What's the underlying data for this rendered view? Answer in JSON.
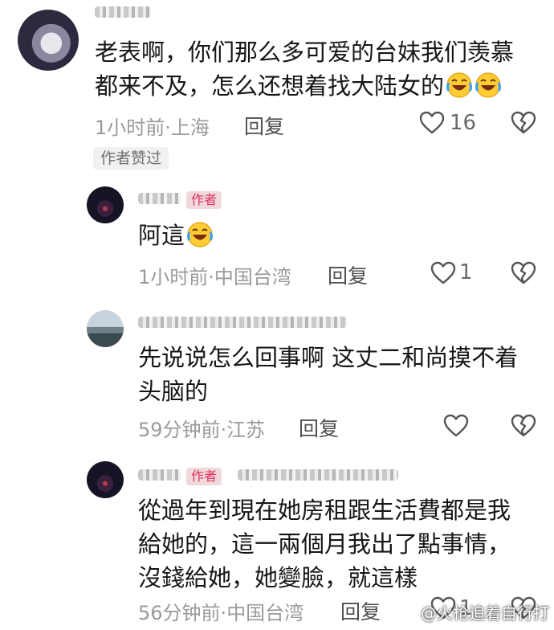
{
  "comments": [
    {
      "text_lines": [
        "老表啊，你们那么多可爱的台妹我们羡慕",
        "都来不及，怎么还想着找大陆女的"
      ],
      "emoji": [
        "laughing-crying-emoji",
        "laughing-crying-emoji"
      ],
      "time": "1小时前",
      "location": "上海",
      "reply_label": "回复",
      "likes": "16",
      "author_liked_tag": "作者赞过"
    },
    {
      "author_badge": "作者",
      "text": "阿這",
      "emoji": [
        "laughing-crying-emoji"
      ],
      "time": "1小时前",
      "location": "中国台湾",
      "reply_label": "回复",
      "likes": "1"
    },
    {
      "text_lines": [
        "先说说怎么回事啊  这丈二和尚摸不着",
        "头脑的"
      ],
      "time": "59分钟前",
      "location": "江苏",
      "reply_label": "回复",
      "likes": ""
    },
    {
      "author_badge": "作者",
      "text_lines": [
        "從過年到現在她房租跟生活費都是我",
        "給她的，這一兩個月我出了點事情，",
        "沒錢給她，她變臉，就這樣"
      ],
      "time": "56分钟前",
      "location": "中国台湾",
      "reply_label": "回复",
      "likes": "1"
    }
  ],
  "separator": "·",
  "watermark": "@火枪追着自行打",
  "colors": {
    "badge_bg": "#f0d9dc",
    "badge_text": "#e0305a",
    "meta_text": "#9a9a9a"
  }
}
